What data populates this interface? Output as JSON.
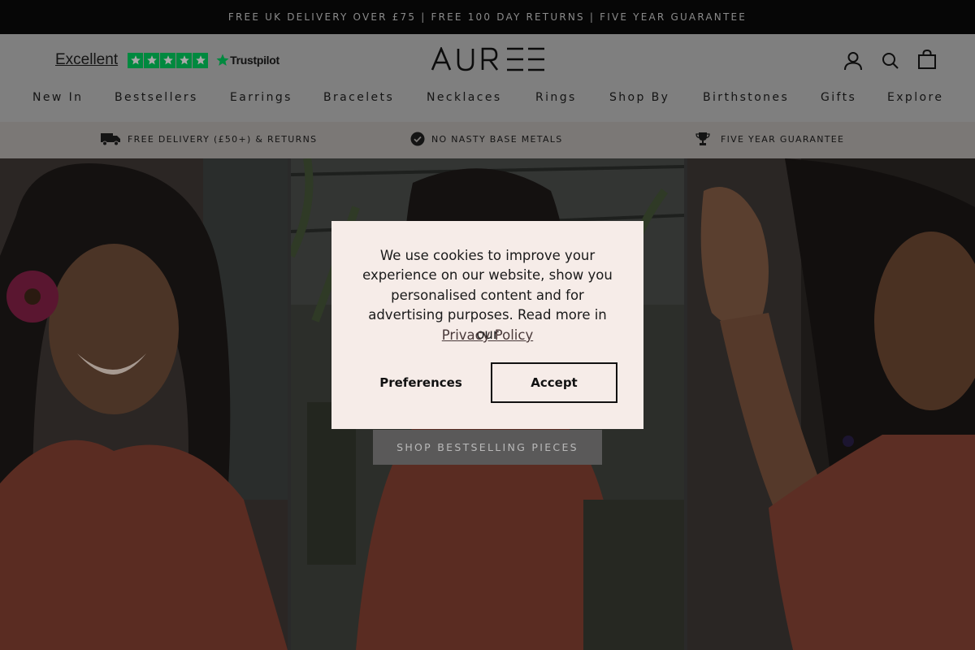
{
  "announcement": "FREE UK DELIVERY OVER £75 | FREE 100 DAY RETURNS | FIVE YEAR GUARANTEE",
  "trustpilot": {
    "rating_label": "Excellent",
    "brand": "Trustpilot",
    "stars": 5
  },
  "logo_text": "AUREE",
  "header_icons": [
    "account-icon",
    "search-icon",
    "bag-icon"
  ],
  "nav": {
    "items": [
      {
        "label": "New In"
      },
      {
        "label": "Bestsellers"
      },
      {
        "label": "Earrings"
      },
      {
        "label": "Bracelets"
      },
      {
        "label": "Necklaces"
      },
      {
        "label": "Rings"
      },
      {
        "label": "Shop By"
      },
      {
        "label": "Birthstones"
      },
      {
        "label": "Gifts"
      },
      {
        "label": "Explore"
      }
    ]
  },
  "usp": [
    {
      "label": "FREE DELIVERY (£50+) & RETURNS",
      "icon": "truck-icon"
    },
    {
      "label": "NO NASTY BASE METALS",
      "icon": "check-badge-icon"
    },
    {
      "label": "FIVE YEAR GUARANTEE",
      "icon": "trophy-icon"
    }
  ],
  "hero": {
    "cta_label": "SHOP BESTSELLING PIECES"
  },
  "cookie_modal": {
    "message": "We use cookies to improve your experience on our website, show you personalised content and for advertising purposes. Read more in our",
    "link_label": "Privacy Policy",
    "preferences_label": "Preferences",
    "accept_label": "Accept"
  },
  "colors": {
    "trustpilot_green": "#00b67a",
    "modal_background": "#f6ece8",
    "dimmed_overlay": "#000000"
  }
}
